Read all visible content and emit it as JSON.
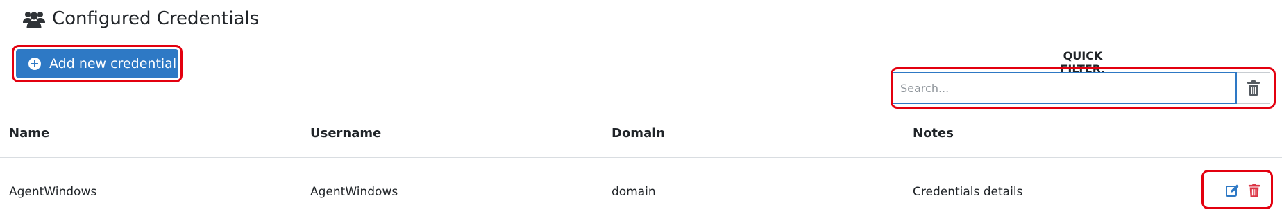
{
  "page": {
    "title": "Configured Credentials",
    "title_icon": "users-icon"
  },
  "toolbar": {
    "add_label": "Add new credential",
    "add_icon": "plus-circle-icon"
  },
  "filter": {
    "label": "QUICK FILTER:",
    "placeholder": "Search...",
    "value": "",
    "clear_icon": "trash-icon"
  },
  "table": {
    "columns": [
      "Name",
      "Username",
      "Domain",
      "Notes"
    ],
    "rows": [
      {
        "name": "AgentWindows",
        "username": "AgentWindows",
        "domain": "domain",
        "notes": "Credentials details",
        "actions": [
          "edit-icon",
          "delete-icon"
        ]
      }
    ]
  },
  "colors": {
    "primary": "#2e79c5",
    "highlight": "#e3000f",
    "danger": "#dc3545",
    "text": "#212529"
  }
}
